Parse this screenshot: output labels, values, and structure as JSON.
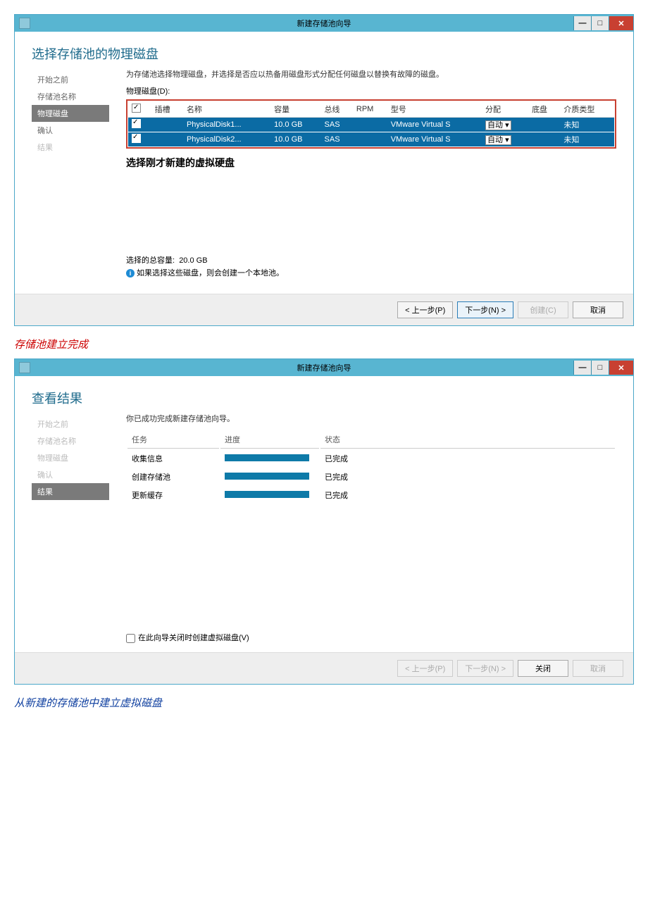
{
  "window1": {
    "title": "新建存储池向导",
    "heading": "选择存储池的物理磁盘",
    "sidebar": [
      {
        "label": "开始之前",
        "state": "normal"
      },
      {
        "label": "存储池名称",
        "state": "normal"
      },
      {
        "label": "物理磁盘",
        "state": "active"
      },
      {
        "label": "确认",
        "state": "normal"
      },
      {
        "label": "结果",
        "state": "disabled"
      }
    ],
    "instruction": "为存储池选择物理磁盘，并选择是否应以热备用磁盘形式分配任何磁盘以替换有故障的磁盘。",
    "disks_label": "物理磁盘(D):",
    "columns": {
      "slot": "插槽",
      "name": "名称",
      "capacity": "容量",
      "bus": "总线",
      "rpm": "RPM",
      "model": "型号",
      "alloc": "分配",
      "chassis": "底盘",
      "media": "介质类型"
    },
    "disks": [
      {
        "name": "PhysicalDisk1...",
        "capacity": "10.0 GB",
        "bus": "SAS",
        "rpm": "",
        "model": "VMware Virtual S",
        "alloc": "自动",
        "media": "未知"
      },
      {
        "name": "PhysicalDisk2...",
        "capacity": "10.0 GB",
        "bus": "SAS",
        "rpm": "",
        "model": "VMware Virtual S",
        "alloc": "自动",
        "media": "未知"
      }
    ],
    "annotation": "选择刚才新建的虚拟硬盘",
    "total_label": "选择的总容量:",
    "total_value": "20.0 GB",
    "info_text": "如果选择这些磁盘，则会创建一个本地池。",
    "buttons": {
      "prev": "< 上一步(P)",
      "next": "下一步(N) >",
      "create": "创建(C)",
      "cancel": "取消"
    }
  },
  "caption1": "存储池建立完成",
  "window2": {
    "title": "新建存储池向导",
    "heading": "查看结果",
    "sidebar": [
      {
        "label": "开始之前",
        "state": "disabled"
      },
      {
        "label": "存储池名称",
        "state": "disabled"
      },
      {
        "label": "物理磁盘",
        "state": "disabled"
      },
      {
        "label": "确认",
        "state": "disabled"
      },
      {
        "label": "结果",
        "state": "active"
      }
    ],
    "success_msg": "你已成功完成新建存储池向导。",
    "result_columns": {
      "task": "任务",
      "progress": "进度",
      "status": "状态"
    },
    "results": [
      {
        "task": "收集信息",
        "status": "已完成"
      },
      {
        "task": "创建存储池",
        "status": "已完成"
      },
      {
        "task": "更新缓存",
        "status": "已完成"
      }
    ],
    "checkbox_label": "在此向导关闭时创建虚拟磁盘(V)",
    "buttons": {
      "prev": "< 上一步(P)",
      "next": "下一步(N) >",
      "close": "关闭",
      "cancel": "取消"
    }
  },
  "caption2": "从新建的存储池中建立虚拟磁盘"
}
